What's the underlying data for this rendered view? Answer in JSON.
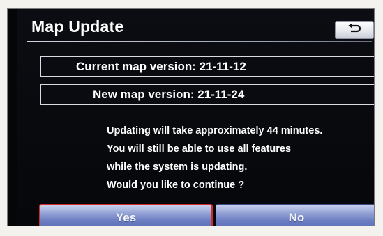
{
  "header": {
    "title": "Map Update",
    "back_icon": "return-arrow-icon"
  },
  "versions": {
    "current_label": "Current map version:",
    "current_value": "21-11-12",
    "new_label": "New map version:",
    "new_value": "21-11-24"
  },
  "message": {
    "lines": [
      "Updating will take approximately 44 minutes.",
      "You will still be able to use all features",
      "while the system is updating.",
      "Would you like to continue ?"
    ]
  },
  "buttons": {
    "yes_label": "Yes",
    "no_label": "No"
  },
  "colors": {
    "background": "#050608",
    "button_blue": "#6c7ec3",
    "focus_border": "#d22a2a"
  }
}
